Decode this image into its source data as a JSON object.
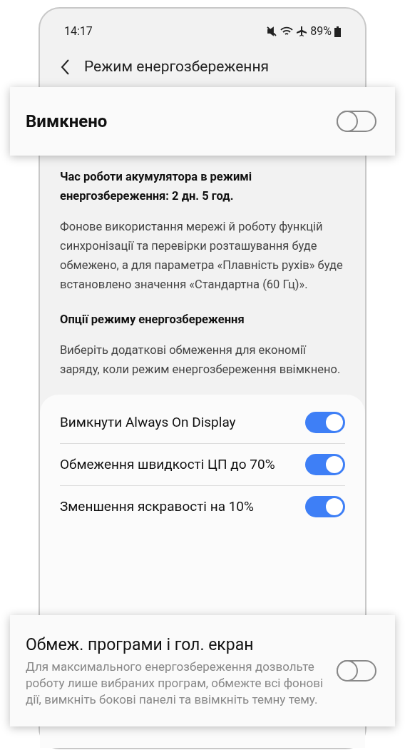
{
  "status_bar": {
    "time": "14:17",
    "battery": "89%"
  },
  "header": {
    "title": "Режим енергозбереження"
  },
  "master": {
    "label": "Вимкнено",
    "on": false
  },
  "battery_time": "Час роботи акумулятора в режимі енергозбереження: 2 дн. 5 год.",
  "description": "Фонове використання мережі й роботу функцій синхронізації та перевірки розташування буде обмежено, а для параметра «Плавність рухів» буде встановлено значення «Стандартна (60 Гц)».",
  "options_heading": "Опції режиму енергозбереження",
  "options_description": "Виберіть додаткові обмеження для економії заряду, коли режим енергозбереження ввімкнено.",
  "options": [
    {
      "label": "Вимкнути Always On Display",
      "on": true
    },
    {
      "label": "Обмеження швидкості ЦП до 70%",
      "on": true
    },
    {
      "label": "Зменшення яскравості на 10%",
      "on": true
    }
  ],
  "limit_apps": {
    "title": "Обмеж. програми і гол. екран",
    "description": "Для максимального енергозбереження дозвольте роботу лише вибраних програм, обмежте всі фонові дії, вимкніть бокові панелі та ввімкніть темну тему.",
    "on": false
  }
}
